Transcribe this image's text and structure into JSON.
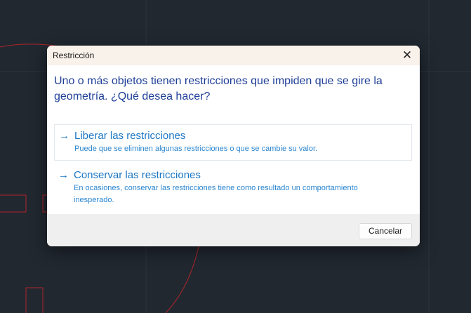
{
  "dialog": {
    "title": "Restricción",
    "close_icon": "close-icon",
    "heading": "Uno o más objetos tienen restricciones que impiden que se gire la geometría. ¿Qué desea hacer?",
    "options": [
      {
        "arrow": "→",
        "label": "Liberar las restricciones",
        "description": "Puede que se eliminen algunas restricciones o que se cambie su valor."
      },
      {
        "arrow": "→",
        "label": "Conservar las restricciones",
        "description": "En ocasiones, conservar las restricciones tiene como resultado un comportamiento inesperado."
      }
    ],
    "cancel_label": "Cancelar",
    "close_glyph": "✕"
  },
  "colors": {
    "canvas": "#212830",
    "heading": "#1f3f98",
    "link": "#1b76c4",
    "drawing": "#c0282d"
  }
}
